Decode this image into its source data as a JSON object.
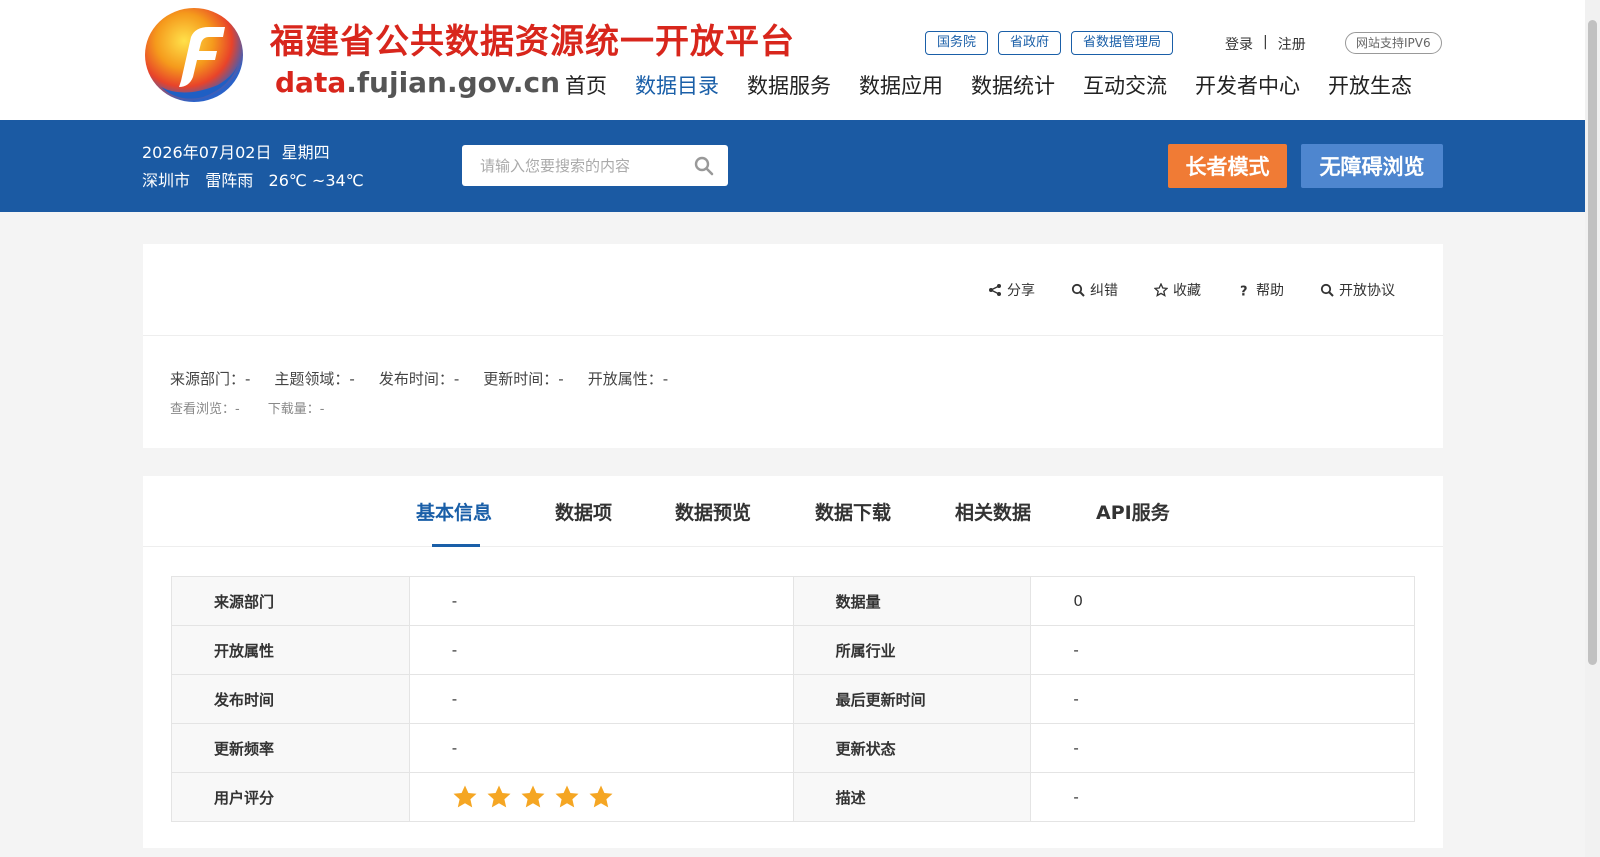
{
  "header": {
    "title": "福建省公共数据资源统一开放平台",
    "domain_prefix": "data",
    "domain_suffix": ".fujian.gov.cn",
    "top_links": [
      "国务院",
      "省政府",
      "省数据管理局"
    ],
    "login": "登录",
    "separator": "|",
    "register": "注册",
    "ipv6": "网站支持IPV6",
    "nav": [
      "首页",
      "数据目录",
      "数据服务",
      "数据应用",
      "数据统计",
      "互动交流",
      "开发者中心",
      "开放生态"
    ],
    "active_nav": "数据目录"
  },
  "band": {
    "date": "2026年07月02日  星期四",
    "weather": "深圳市   雷阵雨   26℃ ~34℃",
    "search_placeholder": "请输入您要搜索的内容",
    "elder_mode": "长者模式",
    "accessible": "无障碍浏览"
  },
  "actions": [
    "分享",
    "纠错",
    "收藏",
    "帮助",
    "开放协议"
  ],
  "meta": {
    "source": "来源部门：-",
    "topic": "主题领域：-",
    "publish": "发布时间：-",
    "update": "更新时间：-",
    "open_attr": "开放属性：-",
    "views": "查看浏览：-",
    "downloads": "下载量：-"
  },
  "tabs": [
    "基本信息",
    "数据项",
    "数据预览",
    "数据下载",
    "相关数据",
    "API服务"
  ],
  "active_tab": "基本信息",
  "info_rows": [
    {
      "k1": "来源部门",
      "v1": "-",
      "k2": "数据量",
      "v2": "0"
    },
    {
      "k1": "开放属性",
      "v1": "-",
      "k2": "所属行业",
      "v2": "-"
    },
    {
      "k1": "发布时间",
      "v1": "-",
      "k2": "最后更新时间",
      "v2": "-"
    },
    {
      "k1": "更新频率",
      "v1": "-",
      "k2": "更新状态",
      "v2": "-"
    },
    {
      "k1": "用户评分",
      "v1": "",
      "k2": "描述",
      "v2": "-"
    }
  ],
  "rating": {
    "value": 5,
    "max": 5
  },
  "colors": {
    "brand_blue": "#1b5aa3",
    "accent_orange": "#f07b35",
    "star": "#f5a623"
  }
}
